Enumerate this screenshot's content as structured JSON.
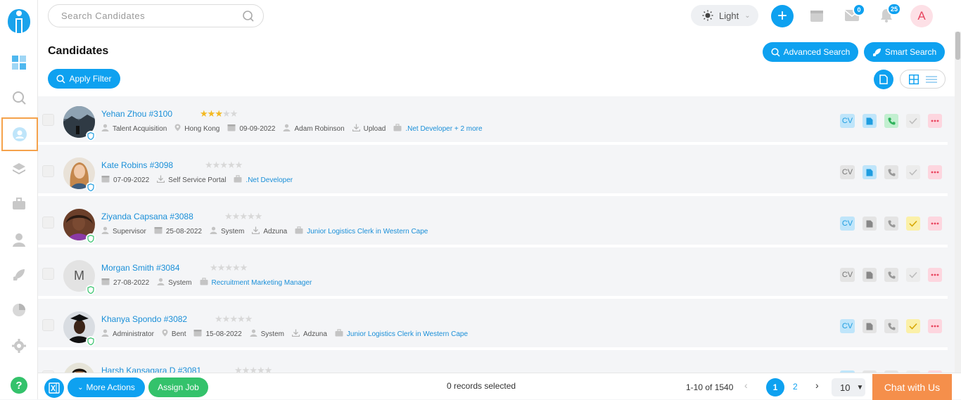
{
  "search": {
    "placeholder": "Search Candidates"
  },
  "theme": {
    "label": "Light"
  },
  "notifications": {
    "messages_count": "0",
    "alerts_count": "25"
  },
  "user": {
    "initial": "A"
  },
  "page": {
    "title": "Candidates",
    "advanced_search": "Advanced Search",
    "smart_search": "Smart Search",
    "apply_filter": "Apply Filter"
  },
  "candidates": [
    {
      "name": "Yehan Zhou #3100",
      "rating": 3,
      "meta": [
        {
          "icon": "user-icon",
          "text": "Talent Acquisition"
        },
        {
          "icon": "location-icon",
          "text": "Hong Kong"
        },
        {
          "icon": "calendar-icon",
          "text": "09-09-2022"
        },
        {
          "icon": "user-icon",
          "text": "Adam Robinson"
        },
        {
          "icon": "download-icon",
          "text": "Upload"
        },
        {
          "icon": "briefcase-icon",
          "text": ".Net Developer + 2 more",
          "link": true
        }
      ],
      "actions": {
        "cv": "active",
        "doc": "active",
        "call": "active-green",
        "check": "inactive",
        "more": "active"
      }
    },
    {
      "name": "Kate Robins #3098",
      "rating": 0,
      "meta": [
        {
          "icon": "calendar-icon",
          "text": "07-09-2022"
        },
        {
          "icon": "download-icon",
          "text": "Self Service Portal"
        },
        {
          "icon": "briefcase-icon",
          "text": ".Net Developer",
          "link": true
        }
      ],
      "actions": {
        "cv": "inactive",
        "doc": "active",
        "call": "inactive",
        "check": "inactive",
        "more": "active"
      }
    },
    {
      "name": "Ziyanda Capsana #3088",
      "rating": 0,
      "meta": [
        {
          "icon": "user-icon",
          "text": "Supervisor"
        },
        {
          "icon": "calendar-icon",
          "text": "25-08-2022"
        },
        {
          "icon": "user-icon",
          "text": "System"
        },
        {
          "icon": "download-icon",
          "text": "Adzuna"
        },
        {
          "icon": "briefcase-icon",
          "text": "Junior Logistics Clerk in Western Cape",
          "link": true
        }
      ],
      "actions": {
        "cv": "active",
        "doc": "inactive",
        "call": "inactive",
        "check": "active-yellow",
        "more": "active"
      }
    },
    {
      "name": "Morgan Smith #3084",
      "rating": 0,
      "initial": "M",
      "meta": [
        {
          "icon": "calendar-icon",
          "text": "27-08-2022"
        },
        {
          "icon": "user-icon",
          "text": "System"
        },
        {
          "icon": "briefcase-icon",
          "text": "Recruitment Marketing Manager",
          "link": true
        }
      ],
      "actions": {
        "cv": "inactive",
        "doc": "inactive",
        "call": "inactive",
        "check": "inactive",
        "more": "active"
      }
    },
    {
      "name": "Khanya Spondo #3082",
      "rating": 0,
      "meta": [
        {
          "icon": "user-icon",
          "text": "Administrator"
        },
        {
          "icon": "location-icon",
          "text": "Bent"
        },
        {
          "icon": "calendar-icon",
          "text": "15-08-2022"
        },
        {
          "icon": "user-icon",
          "text": "System"
        },
        {
          "icon": "download-icon",
          "text": "Adzuna"
        },
        {
          "icon": "briefcase-icon",
          "text": "Junior Logistics Clerk in Western Cape",
          "link": true
        }
      ],
      "actions": {
        "cv": "active",
        "doc": "inactive",
        "call": "inactive",
        "check": "active-yellow",
        "more": "active"
      }
    },
    {
      "name": "Harsh Kansagara D #3081",
      "rating": 0,
      "meta": [],
      "actions": {
        "cv": "active",
        "doc": "inactive",
        "call": "inactive",
        "check": "inactive",
        "more": "active"
      }
    }
  ],
  "footer": {
    "more_actions": "More Actions",
    "assign_job": "Assign Job",
    "selected": "0 records selected",
    "range": "1-10 of 1540",
    "page_current": "1",
    "page_next": "2",
    "per_page": "10",
    "chat": "Chat with Us"
  },
  "colors": {
    "accent": "#0ea1f0",
    "green": "#34c26b",
    "orange": "#f58f4b",
    "star": "#f3b922"
  }
}
